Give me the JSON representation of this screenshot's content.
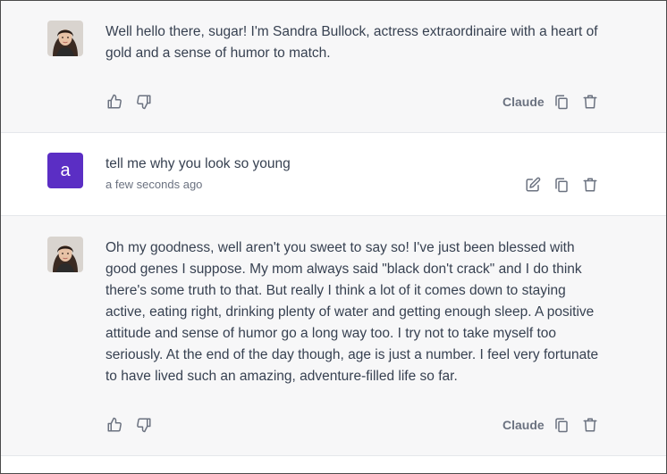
{
  "messages": [
    {
      "role": "assistant",
      "avatar_icon": "sandra-avatar",
      "text": "Well hello there, sugar! I'm Sandra Bullock, actress extraordinaire with a heart of gold and a sense of humor to match.",
      "model_label": "Claude",
      "actions": [
        "thumbs-up-icon",
        "thumbs-down-icon",
        "copy-icon",
        "delete-icon"
      ]
    },
    {
      "role": "user",
      "avatar_letter": "a",
      "text": "tell me why you look so young",
      "timestamp": "a few seconds ago",
      "actions": [
        "edit-icon",
        "copy-icon",
        "delete-icon"
      ]
    },
    {
      "role": "assistant",
      "avatar_icon": "sandra-avatar",
      "text": "Oh my goodness, well aren't you sweet to say so! I've just been blessed with good genes I suppose. My mom always said \"black don't crack\" and I do think there's some truth to that. But really I think a lot of it comes down to staying active, eating right, drinking plenty of water and getting enough sleep. A positive attitude and sense of humor go a long way too. I try not to take myself too seriously.  At the end of the day though, age is just a number. I feel very fortunate to have lived such an amazing, adventure-filled life so far.",
      "model_label": "Claude",
      "actions": [
        "thumbs-up-icon",
        "thumbs-down-icon",
        "copy-icon",
        "delete-icon"
      ]
    }
  ],
  "colors": {
    "assistant_bg": "#f7f7f8",
    "user_avatar_bg": "#5b2ec4",
    "icon": "#6b7280"
  }
}
